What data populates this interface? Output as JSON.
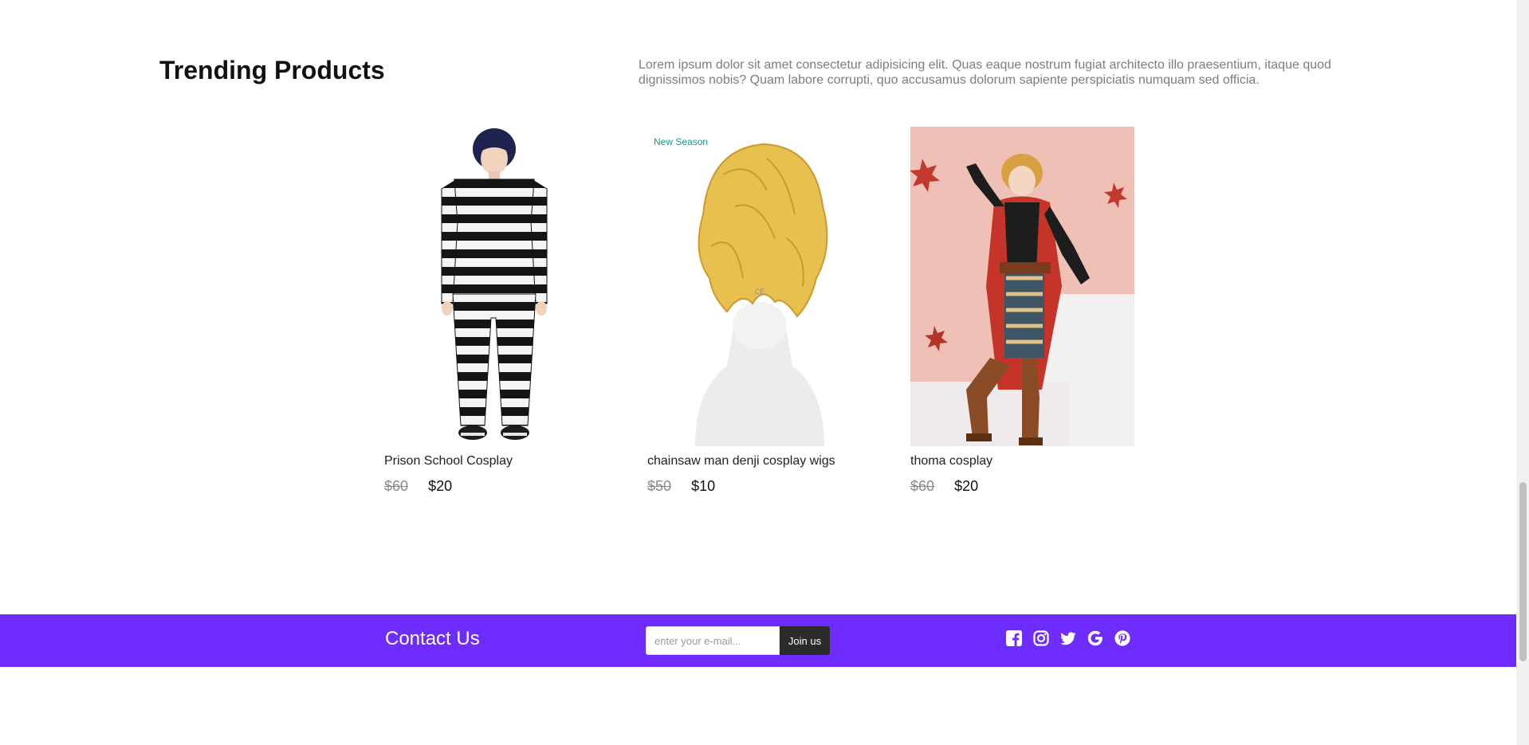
{
  "section": {
    "title": "Trending Products",
    "description": "Lorem ipsum dolor sit amet consectetur adipisicing elit. Quas eaque nostrum fugiat architecto illo praesentium, itaque quod dignissimos nobis? Quam labore corrupti, quo accusamus dolorum sapiente perspiciatis numquam sed officia."
  },
  "products": [
    {
      "name": "Prison School Cosplay",
      "old_price": "$60",
      "price": "$20",
      "badge": ""
    },
    {
      "name": "chainsaw man denji cosplay wigs",
      "old_price": "$50",
      "price": "$10",
      "badge": "New Season"
    },
    {
      "name": "thoma cosplay",
      "old_price": "$60",
      "price": "$20",
      "badge": ""
    }
  ],
  "footer": {
    "title": "Contact Us",
    "email_placeholder": "enter your e-mail...",
    "join_label": "Join us",
    "socials": [
      "facebook-icon",
      "instagram-icon",
      "twitter-icon",
      "google-icon",
      "pinterest-icon"
    ]
  },
  "colors": {
    "footer_bg": "#6e2cff",
    "badge_text": "#1a9b86",
    "join_button_bg": "#2b2b2b",
    "description_text": "#7d7d7d"
  }
}
